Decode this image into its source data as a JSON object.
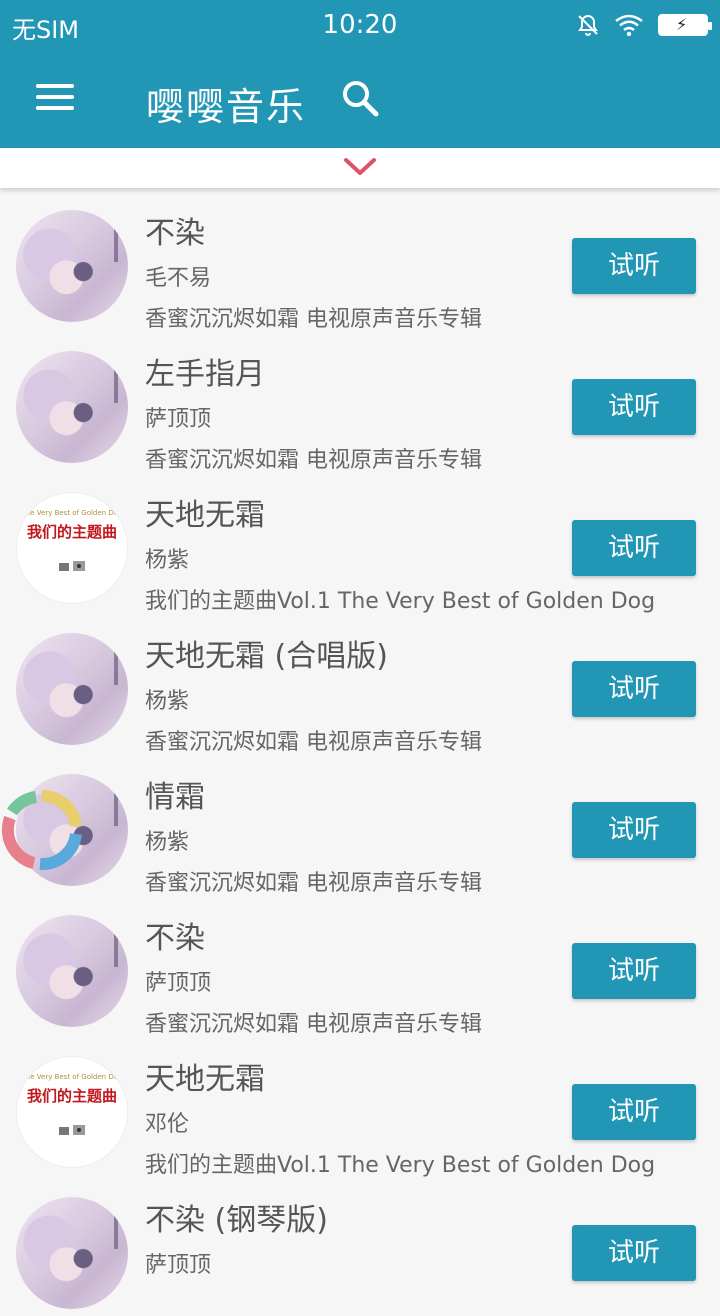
{
  "status_bar": {
    "carrier": "无SIM",
    "time": "10:20",
    "icons": [
      "mute-icon",
      "wifi-icon",
      "battery-charging-icon"
    ]
  },
  "app_bar": {
    "title": "嘤嘤音乐",
    "menu_icon": "menu-icon",
    "search_icon": "search-icon"
  },
  "pull_tab": {
    "icon": "chevron-down-icon",
    "color": "#e0506a"
  },
  "colors": {
    "primary": "#2196b5",
    "background": "#f6f6f6"
  },
  "songs": [
    {
      "title": "不染",
      "artist": "毛不易",
      "album": "香蜜沉沉烬如霜 电视原声音乐专辑",
      "cover": "fairy",
      "button": "试听"
    },
    {
      "title": "左手指月",
      "artist": "萨顶顶",
      "album": "香蜜沉沉烬如霜 电视原声音乐专辑",
      "cover": "fairy",
      "button": "试听"
    },
    {
      "title": "天地无霜",
      "artist": "杨紫",
      "album": "我们的主题曲Vol.1 The Very Best of Golden Dog",
      "cover": "gold",
      "button": "试听"
    },
    {
      "title": "天地无霜 (合唱版)",
      "artist": "杨紫",
      "album": "香蜜沉沉烬如霜 电视原声音乐专辑",
      "cover": "fairy",
      "button": "试听"
    },
    {
      "title": "情霜",
      "artist": "杨紫",
      "album": "香蜜沉沉烬如霜 电视原声音乐专辑",
      "cover": "fairy",
      "button": "试听"
    },
    {
      "title": "不染",
      "artist": "萨顶顶",
      "album": "香蜜沉沉烬如霜 电视原声音乐专辑",
      "cover": "fairy",
      "button": "试听"
    },
    {
      "title": "天地无霜",
      "artist": "邓伦",
      "album": "我们的主题曲Vol.1 The Very Best of Golden Dog",
      "cover": "gold",
      "button": "试听"
    },
    {
      "title": "不染 (钢琴版)",
      "artist": "萨顶顶",
      "album": "",
      "cover": "fairy",
      "button": "试听"
    }
  ],
  "gold_cover": {
    "subtitle": "The Very Best of Golden Dog",
    "title": "我们的主题曲"
  },
  "floating_widget_icon": "assistant-ring-icon"
}
